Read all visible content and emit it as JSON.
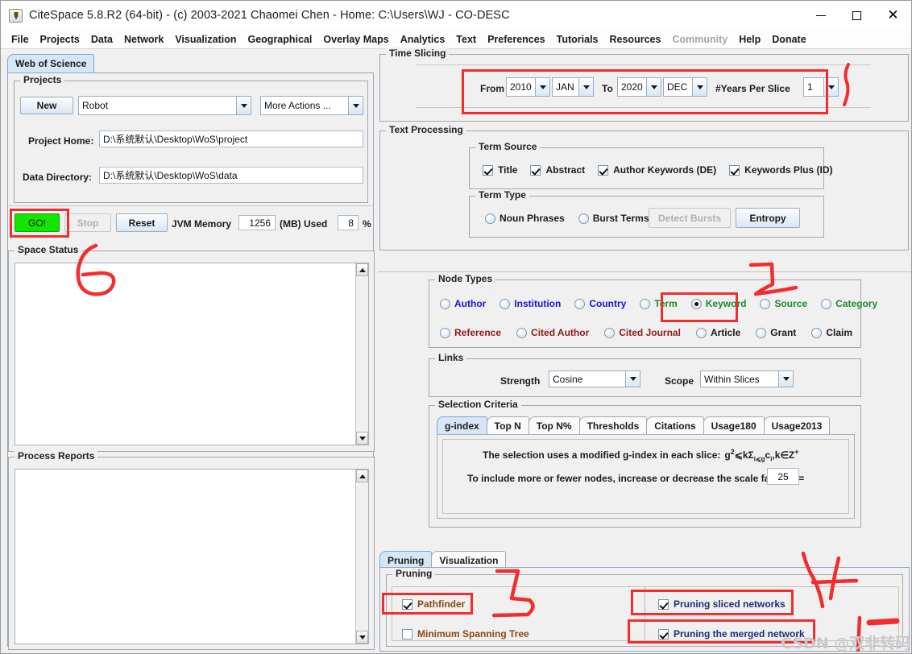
{
  "window": {
    "title": "CiteSpace 5.8.R2 (64-bit) - (c) 2003-2021 Chaomei Chen - Home: C:\\Users\\WJ - CO-DESC",
    "icon": "java-coffee-cup-icon",
    "controls": {
      "minimize": "–",
      "maximize": "□",
      "close": "✕"
    }
  },
  "menubar": {
    "items": [
      {
        "label": "File",
        "enabled": true
      },
      {
        "label": "Projects",
        "enabled": true
      },
      {
        "label": "Data",
        "enabled": true
      },
      {
        "label": "Network",
        "enabled": true
      },
      {
        "label": "Visualization",
        "enabled": true
      },
      {
        "label": "Geographical",
        "enabled": true
      },
      {
        "label": "Overlay Maps",
        "enabled": true
      },
      {
        "label": "Analytics",
        "enabled": true
      },
      {
        "label": "Text",
        "enabled": true
      },
      {
        "label": "Preferences",
        "enabled": true
      },
      {
        "label": "Tutorials",
        "enabled": true
      },
      {
        "label": "Resources",
        "enabled": true
      },
      {
        "label": "Community",
        "enabled": false
      },
      {
        "label": "Help",
        "enabled": true
      },
      {
        "label": "Donate",
        "enabled": true
      }
    ]
  },
  "left": {
    "tab_label": "Web of Science",
    "projects": {
      "legend": "Projects",
      "new_button": "New",
      "project_combo_value": "Robot",
      "more_actions_value": "More Actions ...",
      "project_home_label": "Project Home:",
      "project_home_value": "D:\\系统默认\\Desktop\\WoS\\project",
      "data_directory_label": "Data Directory:",
      "data_directory_value": "D:\\系统默认\\Desktop\\WoS\\data"
    },
    "actions": {
      "go_button": "GO!",
      "stop_button": "Stop",
      "reset_button": "Reset",
      "jvm_memory_label": "JVM Memory",
      "jvm_memory_value": "1256",
      "mb_used_label": "(MB) Used",
      "percent_value": "8",
      "percent_symbol": "%"
    },
    "space_status_legend": "Space Status",
    "process_reports_legend": "Process Reports"
  },
  "time_slicing": {
    "legend": "Time Slicing",
    "from_label": "From",
    "from_year": "2010",
    "from_month": "JAN",
    "to_label": "To",
    "to_year": "2020",
    "to_month": "DEC",
    "years_per_slice_label": "#Years Per Slice",
    "years_per_slice_value": "1"
  },
  "text_processing": {
    "legend": "Text Processing",
    "term_source": {
      "legend": "Term Source",
      "options": [
        {
          "label": "Title",
          "checked": true
        },
        {
          "label": "Abstract",
          "checked": true
        },
        {
          "label": "Author Keywords (DE)",
          "checked": true
        },
        {
          "label": "Keywords Plus (ID)",
          "checked": true
        }
      ]
    },
    "term_type": {
      "legend": "Term Type",
      "options": [
        {
          "label": "Noun Phrases",
          "selected": false
        },
        {
          "label": "Burst Terms",
          "selected": false
        }
      ],
      "detect_bursts_button": "Detect Bursts",
      "detect_bursts_enabled": false,
      "entropy_button": "Entropy"
    }
  },
  "node_types": {
    "legend": "Node Types",
    "row1": [
      {
        "label": "Author",
        "selected": false,
        "color": "#1b12d6"
      },
      {
        "label": "Institution",
        "selected": false,
        "color": "#1b12d6"
      },
      {
        "label": "Country",
        "selected": false,
        "color": "#1b12d6"
      },
      {
        "label": "Term",
        "selected": false,
        "color": "#1a8a2c"
      },
      {
        "label": "Keyword",
        "selected": true,
        "color": "#1a8a2c"
      },
      {
        "label": "Source",
        "selected": false,
        "color": "#1a8a2c"
      },
      {
        "label": "Category",
        "selected": false,
        "color": "#1a8a2c"
      }
    ],
    "row2": [
      {
        "label": "Reference",
        "selected": false,
        "color": "#8e1a1a"
      },
      {
        "label": "Cited Author",
        "selected": false,
        "color": "#8e1a1a"
      },
      {
        "label": "Cited Journal",
        "selected": false,
        "color": "#8e1a1a"
      },
      {
        "label": "Article",
        "selected": false,
        "color": "#1b1b1b"
      },
      {
        "label": "Grant",
        "selected": false,
        "color": "#1b1b1b"
      },
      {
        "label": "Claim",
        "selected": false,
        "color": "#1b1b1b"
      }
    ]
  },
  "links": {
    "legend": "Links",
    "strength_label": "Strength",
    "strength_value": "Cosine",
    "scope_label": "Scope",
    "scope_value": "Within Slices"
  },
  "selection_criteria": {
    "legend": "Selection Criteria",
    "tabs": [
      {
        "label": "g-index",
        "selected": true
      },
      {
        "label": "Top N",
        "selected": false
      },
      {
        "label": "Top N%",
        "selected": false
      },
      {
        "label": "Thresholds",
        "selected": false
      },
      {
        "label": "Citations",
        "selected": false
      },
      {
        "label": "Usage180",
        "selected": false
      },
      {
        "label": "Usage2013",
        "selected": false
      }
    ],
    "description_prefix": "The selection uses a modified g-index in each slice:",
    "formula_g": "g",
    "formula_sup2": "2",
    "formula_le": "⩽",
    "formula_k_sigma": "kΣ",
    "formula_sub_ileg": "i⩽g",
    "formula_c": "c",
    "formula_sub_i": "i",
    "formula_tail": ",k∈Z",
    "formula_sup_plus": "+",
    "scale_label": "To include more or fewer nodes, increase or decrease the scale factor k =",
    "scale_value": "25"
  },
  "bottom": {
    "tabs": [
      {
        "label": "Pruning",
        "selected": true
      },
      {
        "label": "Visualization",
        "selected": false
      }
    ],
    "pruning": {
      "legend": "Pruning",
      "left_options": [
        {
          "label": "Pathfinder",
          "checked": true,
          "color": "#8a4a10"
        },
        {
          "label": "Minimum Spanning Tree",
          "checked": false,
          "color": "#8a4a10"
        }
      ],
      "right_options": [
        {
          "label": "Pruning sliced networks",
          "checked": true,
          "color": "#1b2f7a"
        },
        {
          "label": "Pruning the merged network",
          "checked": true,
          "color": "#1b2f7a"
        }
      ]
    }
  },
  "annotations": {
    "color": "#f22d2d",
    "watermark": "CSDN @双非转码",
    "boxes": [
      "time-slicing-row",
      "go-button",
      "keyword-radio",
      "pathfinder-checkbox",
      "pruning-sliced-networks-checkbox",
      "pruning-merged-network-checkbox"
    ],
    "strokes": [
      "stroke-tick-right-of-time-slicing",
      "stroke-six-over-space-status",
      "stroke-squiggle-over-source",
      "stroke-three-beside-pathfinder",
      "stroke-four-over-pruning-right",
      "stroke-one-dash-bottom-right"
    ]
  }
}
